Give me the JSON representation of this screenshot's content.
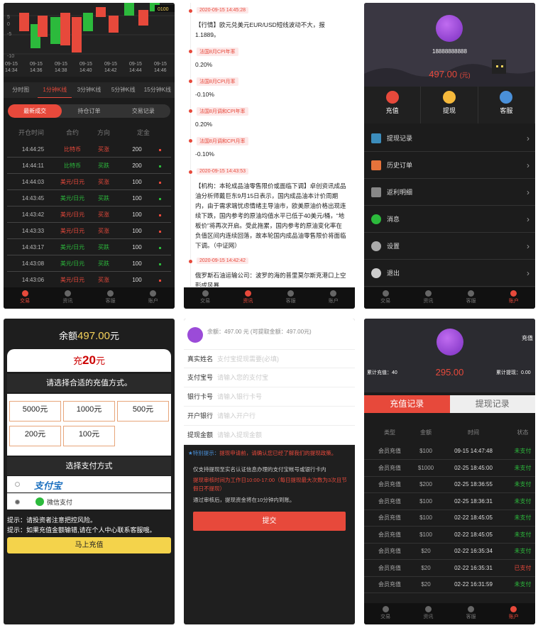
{
  "p1": {
    "axis_y": [
      "5",
      "0",
      "-5",
      "-10"
    ],
    "axis_x": [
      [
        "09-15",
        "14:34"
      ],
      [
        "09-15",
        "14:36"
      ],
      [
        "09-15",
        "14:38"
      ],
      [
        "09-15",
        "14:40"
      ],
      [
        "09-15",
        "14:42"
      ],
      [
        "09-15",
        "14:44"
      ],
      [
        "09-15",
        "14:46"
      ]
    ],
    "price_tag": "0100",
    "tabs": [
      "分时图",
      "1分钟K线",
      "3分钟K线",
      "5分钟K线",
      "15分钟K线"
    ],
    "seg": [
      "最新成交",
      "持仓订单",
      "交易记录"
    ],
    "headers": [
      "开仓时间",
      "合约",
      "方向",
      "定金"
    ],
    "rows": [
      {
        "time": "14:44:25",
        "contract": "比特币",
        "dir": "买涨",
        "amt": "200",
        "c": "red"
      },
      {
        "time": "14:44:11",
        "contract": "比特币",
        "dir": "买跌",
        "amt": "200",
        "c": "green"
      },
      {
        "time": "14:44:03",
        "contract": "美元/日元",
        "dir": "买涨",
        "amt": "100",
        "c": "red"
      },
      {
        "time": "14:43:45",
        "contract": "美元/日元",
        "dir": "买跌",
        "amt": "100",
        "c": "green"
      },
      {
        "time": "14:43:42",
        "contract": "美元/日元",
        "dir": "买涨",
        "amt": "100",
        "c": "red"
      },
      {
        "time": "14:43:33",
        "contract": "美元/日元",
        "dir": "买涨",
        "amt": "100",
        "c": "red"
      },
      {
        "time": "14:43:17",
        "contract": "美元/日元",
        "dir": "买跌",
        "amt": "100",
        "c": "green"
      },
      {
        "time": "14:43:08",
        "contract": "美元/日元",
        "dir": "买跌",
        "amt": "100",
        "c": "green"
      },
      {
        "time": "14:43:06",
        "contract": "美元/日元",
        "dir": "买涨",
        "amt": "100",
        "c": "red"
      }
    ],
    "nav": [
      "交易",
      "资讯",
      "客服",
      "账户"
    ]
  },
  "p2": {
    "items": [
      {
        "tag": "2020-09-15 14:45:28",
        "text": "【行情】欧元兑美元EUR/USD短线波动不大，报1.1889。"
      },
      {
        "tag": "法国8月CPI年率",
        "text": "0.20%"
      },
      {
        "tag": "法国8月CPI月率",
        "text": "-0.10%"
      },
      {
        "tag": "法国8月调和CPI年率",
        "text": "0.20%"
      },
      {
        "tag": "法国8月调和CPI月率",
        "text": "-0.10%"
      },
      {
        "tag": "2020-09-15 14:43:53",
        "text": "【机构：本轮成品油零售限价或面临下调】卓创资讯成品油分析师戴巨东9月15日表示，国内成品油本计价周期内，由于需求端忧虑情绪主导油市，欧美原油价格出现连续下跌，国内参考的原油均值水平已低于40美元/桶，“地板价”将再次开启。受此拖累，国内参考的原油变化率在负值区间内连续回落，故本轮国内成品油零售限价将面临下调。（中证网）"
      },
      {
        "tag": "2020-09-15 14:42:42",
        "text": "俄罗斯石油运输公司：波罗的海的普里莫尔斯克港口上空形成风暴"
      }
    ],
    "nav": [
      "交易",
      "资讯",
      "客服",
      "账户"
    ]
  },
  "p3": {
    "phone": "18888888888",
    "balance": "497.00",
    "unit": "(元)",
    "quick": [
      "充值",
      "提现",
      "客服"
    ],
    "menu": [
      "提现记录",
      "历史订单",
      "返利明细",
      "消息",
      "设置",
      "退出"
    ],
    "nav": [
      "交易",
      "资讯",
      "客服",
      "账户"
    ]
  },
  "p4": {
    "balance_label": "余额",
    "balance": "497.00",
    "unit": "元",
    "recharge_prefix": "充",
    "recharge_amount": "20",
    "recharge_unit": "元",
    "choose_method": "请选择合适的充值方式。",
    "amounts": [
      "5000元",
      "1000元",
      "500元",
      "200元",
      "100元"
    ],
    "pay_title": "选择支付方式",
    "alipay": "支付宝",
    "wechat": "微信支付",
    "hint1": "提示：请投资者注意把控风险。",
    "hint2": "提示：如果充值金额输错,请在个人中心联系客服哦。",
    "submit": "马上充值"
  },
  "p5": {
    "balance_text": "余额：497.00 元 (可提取金额：497.00元)",
    "fields": [
      {
        "label": "真实姓名",
        "ph": "支付宝提现需要(必填)"
      },
      {
        "label": "支付宝号",
        "ph": "请输入您的支付宝"
      },
      {
        "label": "银行卡号",
        "ph": "请输入银行卡号"
      },
      {
        "label": "开户银行",
        "ph": "请输入开户行"
      },
      {
        "label": "提现金额",
        "ph": "请输入提现金额"
      }
    ],
    "tip_label": "★特别提示：",
    "tip": "提现申请前，请确认您已经了解我们的提现政策。",
    "note1": "仅支持提现至实名认证信息办理的支付宝帐号或银行卡内",
    "note2": "提现审核时间为工作日10:00-17:00（每日提现最大次数为3次且节假日不提现）",
    "note3": "通过审核后，提现资金将在10分钟内到账。",
    "submit": "提交"
  },
  "p6": {
    "recharge_btn_text": "充值",
    "total_recharge": "累计充值：40",
    "total_withdraw": "累计提现：0.00",
    "balance": "295.00",
    "tabs": [
      "充值记录",
      "提现记录"
    ],
    "headers": [
      "类型",
      "金额",
      "时间",
      "状态"
    ],
    "rows": [
      {
        "type": "会员充值",
        "amt": "$100",
        "time": "09-15 14:47:48",
        "status": "未支付",
        "c": "green"
      },
      {
        "type": "会员充值",
        "amt": "$1000",
        "time": "02-25 18:45:00",
        "status": "未支付",
        "c": "green"
      },
      {
        "type": "会员充值",
        "amt": "$200",
        "time": "02-25 18:36:55",
        "status": "未支付",
        "c": "green"
      },
      {
        "type": "会员充值",
        "amt": "$100",
        "time": "02-25 18:36:31",
        "status": "未支付",
        "c": "green"
      },
      {
        "type": "会员充值",
        "amt": "$100",
        "time": "02-22 18:45:05",
        "status": "未支付",
        "c": "green"
      },
      {
        "type": "会员充值",
        "amt": "$100",
        "time": "02-22 18:45:05",
        "status": "未支付",
        "c": "green"
      },
      {
        "type": "会员充值",
        "amt": "$20",
        "time": "02-22 16:35:34",
        "status": "未支付",
        "c": "green"
      },
      {
        "type": "会员充值",
        "amt": "$20",
        "time": "02-22 16:35:31",
        "status": "已支付",
        "c": "red"
      },
      {
        "type": "会员充值",
        "amt": "$20",
        "time": "02-22 16:31:59",
        "status": "未支付",
        "c": "green"
      }
    ],
    "nav": [
      "交易",
      "资讯",
      "客服",
      "账户"
    ]
  },
  "colors": {
    "red": "#e7493b",
    "green": "#2cba3c",
    "gold": "#f6d35b"
  },
  "icons": [
    "clock-icon",
    "newspaper-icon",
    "headset-icon",
    "user-icon",
    "wallet-icon",
    "recharge-icon",
    "arrow-right-icon"
  ]
}
